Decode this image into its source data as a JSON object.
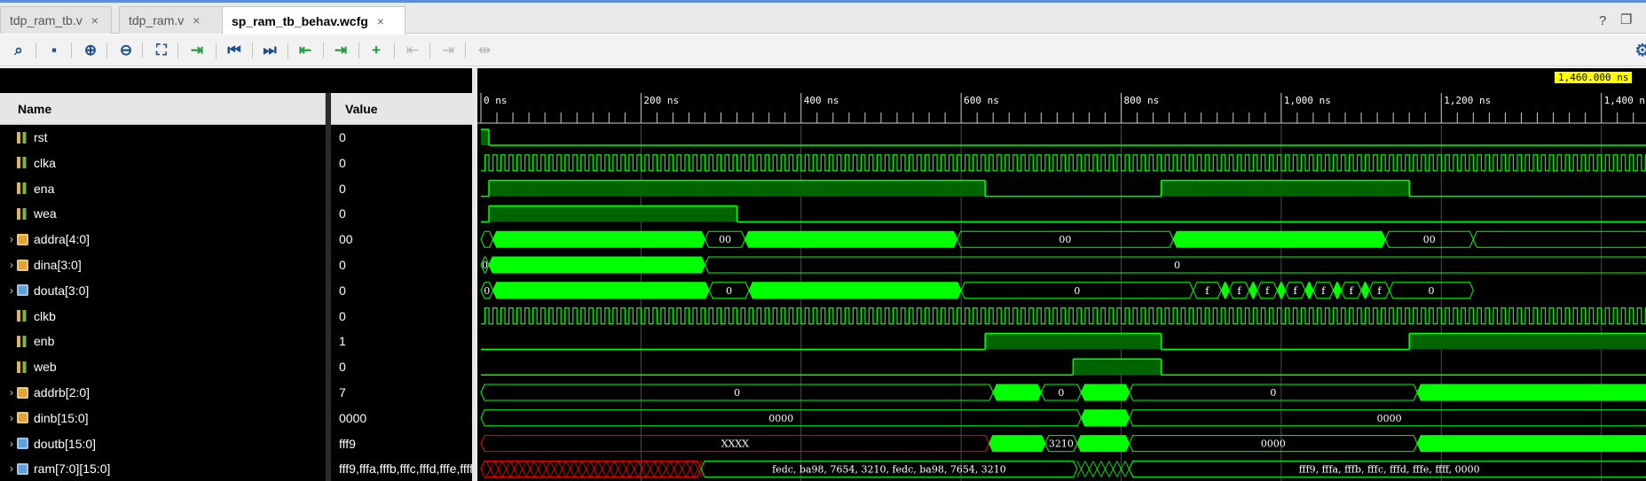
{
  "tabs": [
    {
      "label": "tdp_ram_tb.v",
      "close": "×",
      "active": false
    },
    {
      "label": "tdp_ram.v",
      "close": "×",
      "active": false
    },
    {
      "label": "sp_ram_tb_behav.wcfg",
      "close": "×",
      "active": true
    }
  ],
  "tab_controls": {
    "help": "?",
    "restore": "❐"
  },
  "toolbar": [
    {
      "icon": "search-icon",
      "glyph": "⌕"
    },
    {
      "icon": "save-icon",
      "glyph": "▪"
    },
    {
      "icon": "zoom-in-icon",
      "glyph": "⊕"
    },
    {
      "icon": "zoom-out-icon",
      "glyph": "⊖"
    },
    {
      "icon": "zoom-fit-icon",
      "glyph": "⛶"
    },
    {
      "icon": "go-to-cursor-icon",
      "glyph": "⇥"
    },
    {
      "icon": "go-to-time-0-icon",
      "glyph": "⏮"
    },
    {
      "icon": "go-to-last-time-icon",
      "glyph": "⏭"
    },
    {
      "icon": "previous-transition-icon",
      "glyph": "⇤"
    },
    {
      "icon": "next-transition-icon",
      "glyph": "⇥"
    },
    {
      "icon": "add-marker-icon",
      "glyph": "+"
    },
    {
      "icon": "previous-marker-icon",
      "glyph": "⇤"
    },
    {
      "icon": "next-marker-icon",
      "glyph": "⇥"
    },
    {
      "icon": "swap-cursors-icon",
      "glyph": "⇹"
    }
  ],
  "columns": {
    "name": "Name",
    "value": "Value"
  },
  "cursor_time": "1,460.000 ns",
  "time_axis": {
    "unit": "ns",
    "start": 0,
    "end": 1460,
    "major_labels": [
      "0 ns",
      "200 ns",
      "400 ns",
      "600 ns",
      "800 ns",
      "1,000 ns",
      "1,200 ns",
      "1,400 ns"
    ],
    "major_values": [
      0,
      200,
      400,
      600,
      800,
      1000,
      1200,
      1400
    ]
  },
  "signals": [
    {
      "name": "rst",
      "value": "0",
      "kind": "bit",
      "expandable": false
    },
    {
      "name": "clka",
      "value": "0",
      "kind": "bit",
      "expandable": false
    },
    {
      "name": "ena",
      "value": "0",
      "kind": "bit",
      "expandable": false
    },
    {
      "name": "wea",
      "value": "0",
      "kind": "bit",
      "expandable": false
    },
    {
      "name": "addra[4:0]",
      "value": "00",
      "kind": "bus",
      "expandable": true
    },
    {
      "name": "dina[3:0]",
      "value": "0",
      "kind": "bus",
      "expandable": true
    },
    {
      "name": "douta[3:0]",
      "value": "0",
      "kind": "bus-out",
      "expandable": true
    },
    {
      "name": "clkb",
      "value": "0",
      "kind": "bit",
      "expandable": false
    },
    {
      "name": "enb",
      "value": "1",
      "kind": "bit",
      "expandable": false
    },
    {
      "name": "web",
      "value": "0",
      "kind": "bit",
      "expandable": false
    },
    {
      "name": "addrb[2:0]",
      "value": "7",
      "kind": "bus",
      "expandable": true
    },
    {
      "name": "dinb[15:0]",
      "value": "0000",
      "kind": "bus",
      "expandable": true
    },
    {
      "name": "doutb[15:0]",
      "value": "fff9",
      "kind": "bus-out",
      "expandable": true
    },
    {
      "name": "ram[7:0][15:0]",
      "value": "fff9,fffa,fffb,fffc,fffd,fffe,ffff,0000",
      "kind": "bus-out",
      "expandable": true
    }
  ],
  "bus_labels": {
    "addra": [
      "00",
      "00",
      "00"
    ],
    "dina": [
      "0",
      "0"
    ],
    "douta": [
      "0",
      "0",
      "0",
      "0",
      "f",
      "f",
      "f",
      "f",
      "f",
      "f",
      "f",
      "0"
    ],
    "addrb": [
      "0",
      "0",
      "0"
    ],
    "dinb": [
      "0000",
      "0000"
    ],
    "doutb": [
      "XXXX",
      "3210",
      "0000"
    ],
    "ram": [
      "fedc, ba98, 7654, 3210, fedc, ba98, 7654, 3210",
      "fff9, fffa, fffb, fffc, fffd, fffe, ffff, 0000"
    ]
  },
  "colors": {
    "wave": "#00ff00",
    "wave_fill": "#006400",
    "undefined": "#ff0000",
    "grid": "#4d4d4d",
    "cursor": "#ffff00"
  }
}
